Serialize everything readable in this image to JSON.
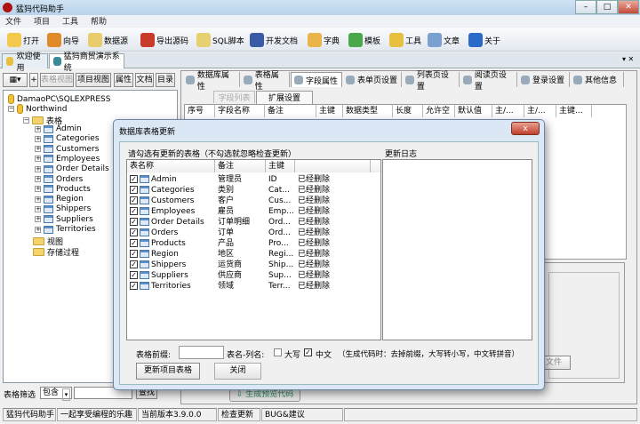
{
  "window": {
    "title": "猛犸代码助手"
  },
  "menu": [
    "文件",
    "项目",
    "工具",
    "帮助"
  ],
  "toolbar": [
    {
      "label": "打开",
      "icon": "folder-open-icon",
      "color": "#f2c94c"
    },
    {
      "label": "向导",
      "icon": "wizard-icon",
      "color": "#e08a2a"
    },
    {
      "label": "数据源",
      "icon": "datasource-icon",
      "color": "#e8cd6a"
    },
    {
      "label": "导出源码",
      "icon": "export-truck-icon",
      "color": "#c83a2a"
    },
    {
      "label": "SQL脚本",
      "icon": "sql-script-icon",
      "color": "#e6d070"
    },
    {
      "label": "开发文档",
      "icon": "word-document-icon",
      "color": "#3a5aa8"
    },
    {
      "label": "字典",
      "icon": "dictionary-icon",
      "color": "#e9b44a"
    },
    {
      "label": "模板",
      "icon": "template-icon",
      "color": "#4aa84a"
    },
    {
      "label": "工具",
      "icon": "tools-icon",
      "color": "#e8c040"
    },
    {
      "label": "文章",
      "icon": "article-icon",
      "color": "#7aa0d0"
    },
    {
      "label": "关于",
      "icon": "help-icon",
      "color": "#2a6ac8"
    }
  ],
  "doc_tabs": [
    "欢迎使用",
    "猛犸商贸演示系统"
  ],
  "left_toolbar": {
    "plus": "+",
    "table_view": "表格视图",
    "project_view": "项目视图",
    "properties": "属性",
    "docs": "文档",
    "catalog": "目录"
  },
  "tree": {
    "server": "DamaoPC\\SQLEXPRESS",
    "database": "Northwind",
    "tables_folder": "表格",
    "tables": [
      "Admin",
      "Categories",
      "Customers",
      "Employees",
      "Order Details",
      "Orders",
      "Products",
      "Region",
      "Shippers",
      "Suppliers",
      "Territories"
    ],
    "views_folder": "视图",
    "procs_folder": "存储过程"
  },
  "filter": {
    "label": "表格筛选",
    "mode": "包含",
    "value": "",
    "search": "查找"
  },
  "right_tabs": [
    "数据库属性",
    "表格属性",
    "字段属性",
    "表单页设置",
    "列表页设置",
    "阅读页设置",
    "登录设置",
    "其他信息"
  ],
  "sub_tabs": [
    "字段列表",
    "扩展设置"
  ],
  "grid_columns": [
    "序号",
    "字段名称",
    "备注",
    "主键",
    "数据类型",
    "长度",
    "允许空",
    "默认值",
    "主/...",
    "主/...",
    "主键..."
  ],
  "generate_preview": "生成预览代码",
  "partial_button": "文件",
  "dialog": {
    "title": "数据库表格更新",
    "close": "x",
    "instruction": "请勾选有更新的表格（不勾选就忽略检查更新）",
    "log_label": "更新日志",
    "columns": [
      "表名称",
      "备注",
      "主键",
      ""
    ],
    "rows": [
      {
        "name": "Admin",
        "remark": "管理员",
        "pk": "ID",
        "status": "已经删除",
        "checked": true
      },
      {
        "name": "Categories",
        "remark": "类别",
        "pk": "Cat...",
        "status": "已经删除",
        "checked": true
      },
      {
        "name": "Customers",
        "remark": "客户",
        "pk": "Cus...",
        "status": "已经删除",
        "checked": true
      },
      {
        "name": "Employees",
        "remark": "雇员",
        "pk": "Emp...",
        "status": "已经删除",
        "checked": true
      },
      {
        "name": "Order Details",
        "remark": "订单明细",
        "pk": "Ord...",
        "status": "已经删除",
        "checked": true
      },
      {
        "name": "Orders",
        "remark": "订单",
        "pk": "Ord...",
        "status": "已经删除",
        "checked": true
      },
      {
        "name": "Products",
        "remark": "产品",
        "pk": "Pro...",
        "status": "已经删除",
        "checked": true
      },
      {
        "name": "Region",
        "remark": "地区",
        "pk": "Regi...",
        "status": "已经删除",
        "checked": true
      },
      {
        "name": "Shippers",
        "remark": "运货商",
        "pk": "Ship...",
        "status": "已经删除",
        "checked": true
      },
      {
        "name": "Suppliers",
        "remark": "供应商",
        "pk": "Sup...",
        "status": "已经删除",
        "checked": true
      },
      {
        "name": "Territories",
        "remark": "领域",
        "pk": "Terr...",
        "status": "已经删除",
        "checked": true
      }
    ],
    "prefix_label": "表格前缀:",
    "prefix_value": "",
    "naming_label": "表名-列名:",
    "uppercase_label": "大写",
    "uppercase_checked": false,
    "chinese_label": "中文",
    "chinese_checked": true,
    "hint": "（生成代码时：去掉前缀，大写转小写，中文转拼音）",
    "update_button": "更新项目表格",
    "close_button": "关闭"
  },
  "status": [
    "猛犸代码助手",
    "一起享受编程的乐趣",
    "当前版本3.9.0.0",
    "检查更新",
    "BUG&建议"
  ]
}
